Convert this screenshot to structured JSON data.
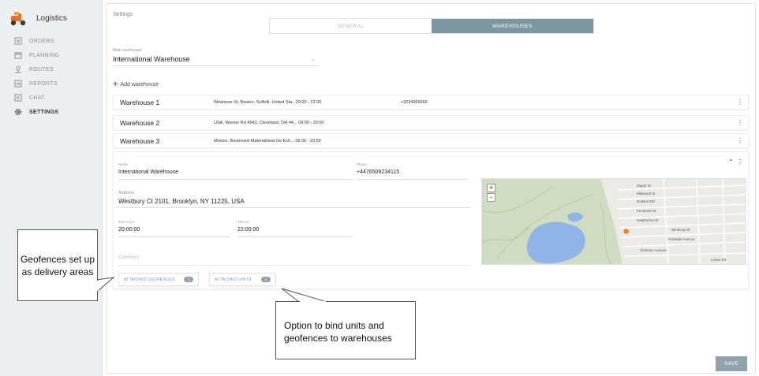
{
  "app": {
    "title": "Logistics"
  },
  "sidebar": {
    "items": [
      {
        "label": "ORDERS",
        "icon": "orders-icon"
      },
      {
        "label": "PLANNING",
        "icon": "calendar-icon"
      },
      {
        "label": "ROUTES",
        "icon": "route-icon"
      },
      {
        "label": "REPORTS",
        "icon": "reports-icon"
      },
      {
        "label": "CHAT",
        "icon": "chat-icon"
      },
      {
        "label": "SETTINGS",
        "icon": "gear-icon",
        "active": true
      }
    ]
  },
  "header": {
    "breadcrumb": "Settings"
  },
  "tabs": [
    {
      "label": "GENERAL",
      "active": false
    },
    {
      "label": "WAREHOUSES",
      "active": true
    }
  ],
  "main_warehouse": {
    "label": "Main warehouse",
    "value": "International Warehouse"
  },
  "add_warehouse_label": "Add warehouse",
  "warehouses": [
    {
      "name": "Warehouse 1",
      "address": "Wedmore St, Boston, Suffolk, United Sta.. 20:00 - 22:00",
      "phone": "+9234966666"
    },
    {
      "name": "Warehouse 2",
      "address": "USA, Warner Rd 4543, Cleveland, OH 44... 09:00 - 20:00",
      "phone": ""
    },
    {
      "name": "Warehouse 3",
      "address": "Mexico, Boulevard Materialistas De Ech... 06:00 - 23:59",
      "phone": ""
    }
  ],
  "editor": {
    "name_label": "Name",
    "name_value": "International Warehouse",
    "phone_label": "Phone",
    "phone_value": "+4476509234115",
    "address_label": "Address",
    "address_value": "Westbury Ct 2101, Brooklyn, NY 11225, USA",
    "time_from_label": "Time from",
    "time_from_value": "20:00:00",
    "time_to_label": "Time to",
    "time_to_value": "22:00:00",
    "comment_placeholder": "Comment",
    "attached_geofences_label": "ATTACHED GEOFENCES",
    "attached_geofences_count": "1",
    "attached_units_label": "ATTACHED UNITS",
    "attached_units_count": "3"
  },
  "map": {
    "zoom_in": "+",
    "zoom_out": "-",
    "street_labels": [
      "Maple St",
      "Midwood St",
      "Rutland Rd",
      "Fenimore St",
      "Hawthorne St",
      "Winthrop St",
      "Parkside Avenue",
      "Clarkson Avenue",
      "Lenox Rd"
    ],
    "colors": {
      "park": "#cfdcbf",
      "water": "#8fb4e8",
      "blocks": "#eceae6"
    }
  },
  "save_label": "SAVE",
  "callouts": {
    "geofences": "Geofences set up as delivery areas",
    "bind": "Option to bind units and geofences to warehouses"
  },
  "colors": {
    "accent": "#7d97a1",
    "add_icon": "#43a047",
    "marker": "#f2842b"
  }
}
